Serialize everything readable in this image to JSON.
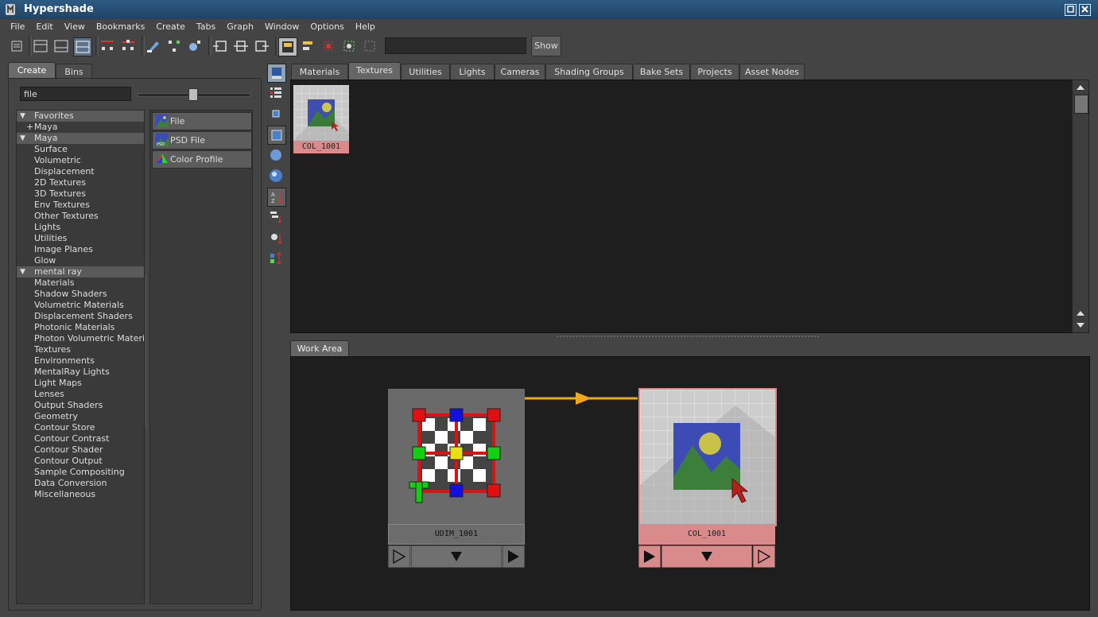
{
  "window": {
    "title": "Hypershade"
  },
  "menu": [
    "File",
    "Edit",
    "View",
    "Bookmarks",
    "Create",
    "Tabs",
    "Graph",
    "Window",
    "Options",
    "Help"
  ],
  "toolbar": {
    "show_label": "Show",
    "field_value": ""
  },
  "left_panel": {
    "tabs": [
      "Create",
      "Bins"
    ],
    "active_tab": "Create",
    "search_value": "file",
    "tree": [
      {
        "label": "Favorites",
        "type": "group"
      },
      {
        "label": "Maya",
        "type": "sub",
        "prefix": "+"
      },
      {
        "label": "Maya",
        "type": "group"
      },
      {
        "label": "Surface",
        "type": "item"
      },
      {
        "label": "Volumetric",
        "type": "item"
      },
      {
        "label": "Displacement",
        "type": "item"
      },
      {
        "label": "2D Textures",
        "type": "item"
      },
      {
        "label": "3D Textures",
        "type": "item"
      },
      {
        "label": "Env Textures",
        "type": "item"
      },
      {
        "label": "Other Textures",
        "type": "item"
      },
      {
        "label": "Lights",
        "type": "item"
      },
      {
        "label": "Utilities",
        "type": "item"
      },
      {
        "label": "Image Planes",
        "type": "item"
      },
      {
        "label": "Glow",
        "type": "item"
      },
      {
        "label": "mental ray",
        "type": "group"
      },
      {
        "label": "Materials",
        "type": "item"
      },
      {
        "label": "Shadow Shaders",
        "type": "item"
      },
      {
        "label": "Volumetric Materials",
        "type": "item"
      },
      {
        "label": "Displacement Shaders",
        "type": "item"
      },
      {
        "label": "Photonic Materials",
        "type": "item"
      },
      {
        "label": "Photon Volumetric Materi...",
        "type": "item"
      },
      {
        "label": "Textures",
        "type": "item"
      },
      {
        "label": "Environments",
        "type": "item"
      },
      {
        "label": "MentalRay Lights",
        "type": "item"
      },
      {
        "label": "Light Maps",
        "type": "item"
      },
      {
        "label": "Lenses",
        "type": "item"
      },
      {
        "label": "Output Shaders",
        "type": "item"
      },
      {
        "label": "Geometry",
        "type": "item"
      },
      {
        "label": "Contour Store",
        "type": "item"
      },
      {
        "label": "Contour Contrast",
        "type": "item"
      },
      {
        "label": "Contour Shader",
        "type": "item"
      },
      {
        "label": "Contour Output",
        "type": "item"
      },
      {
        "label": "Sample Compositing",
        "type": "item"
      },
      {
        "label": "Data Conversion",
        "type": "item"
      },
      {
        "label": "Miscellaneous",
        "type": "item"
      }
    ],
    "nodes": [
      {
        "label": "File",
        "icon": "file-texture-icon"
      },
      {
        "label": "PSD File",
        "icon": "psd-file-icon"
      },
      {
        "label": "Color Profile",
        "icon": "color-profile-icon"
      }
    ]
  },
  "top_tabs": [
    "Materials",
    "Textures",
    "Utilities",
    "Lights",
    "Cameras",
    "Shading Groups",
    "Bake Sets",
    "Projects",
    "Asset Nodes"
  ],
  "top_active_tab": "Textures",
  "top_swatches": [
    {
      "label": "COL_1001"
    }
  ],
  "work_area": {
    "tab": "Work Area",
    "nodes": [
      {
        "label": "UDIM_1001",
        "kind": "place2dTexture"
      },
      {
        "label": "COL_1001",
        "kind": "file"
      }
    ],
    "connection_color": "#f0a818"
  },
  "colors": {
    "selected_node": "#d98a8a",
    "accent": "#f0a818",
    "titlebar": "#2b5279"
  }
}
